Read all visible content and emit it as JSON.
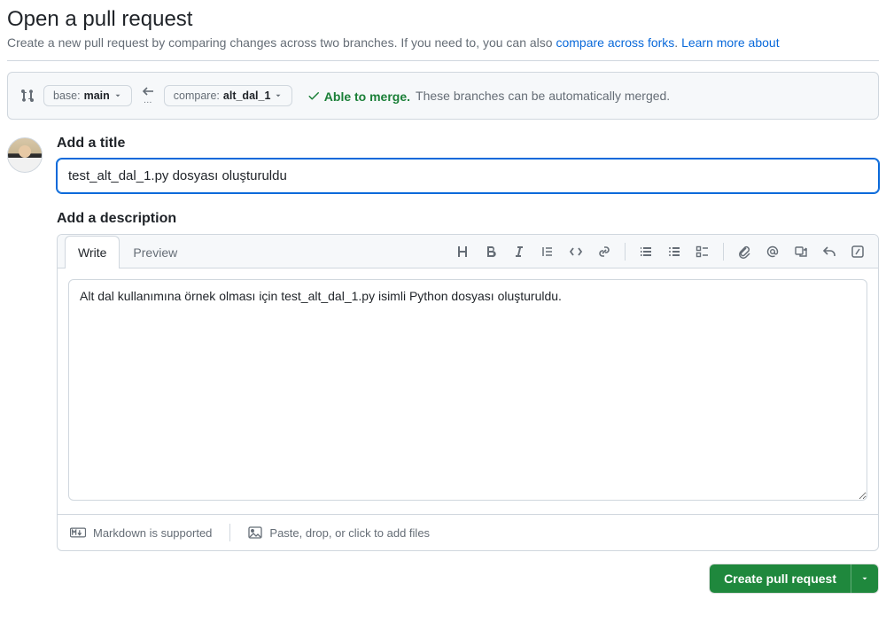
{
  "header": {
    "title": "Open a pull request",
    "subtitle_pre": "Create a new pull request by comparing changes across two branches. If you need to, you can also ",
    "link_compare": "compare across forks",
    "subtitle_mid": ". ",
    "link_learn": "Learn more about "
  },
  "branch_bar": {
    "base_label": "base: ",
    "base_value": "main",
    "compare_label": "compare: ",
    "compare_value": "alt_dal_1",
    "merge_ok": "Able to merge.",
    "merge_msg": " These branches can be automatically merged."
  },
  "form": {
    "title_label": "Add a title",
    "title_value": "test_alt_dal_1.py dosyası oluşturuldu",
    "desc_label": "Add a description",
    "desc_value": "Alt dal kullanımına örnek olması için test_alt_dal_1.py isimli Python dosyası oluşturuldu."
  },
  "tabs": {
    "write": "Write",
    "preview": "Preview"
  },
  "footer": {
    "markdown": "Markdown is supported",
    "attach": "Paste, drop, or click to add files"
  },
  "submit": {
    "label": "Create pull request"
  }
}
